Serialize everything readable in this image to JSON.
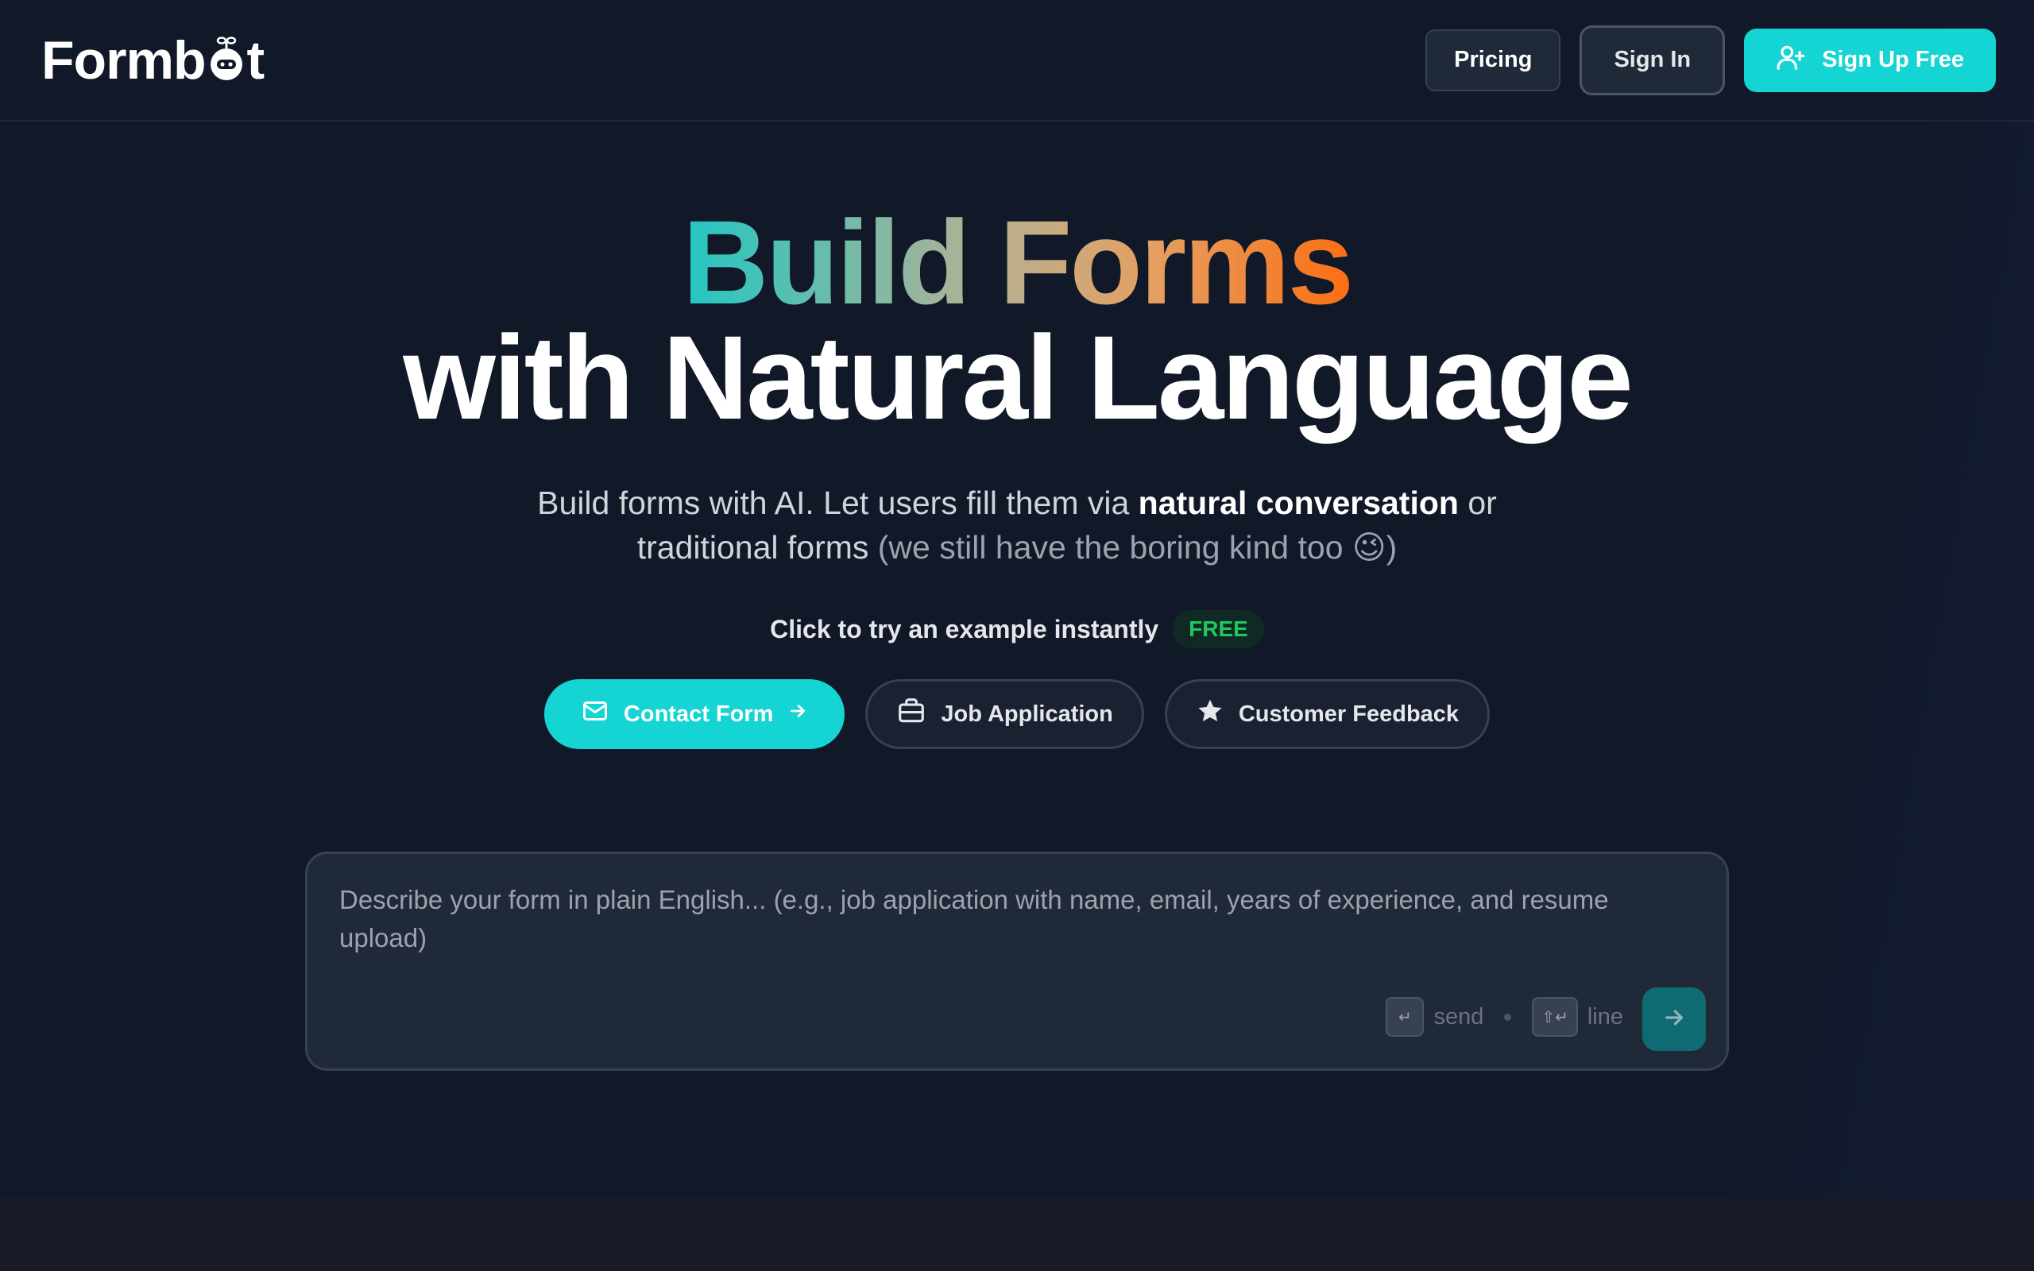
{
  "header": {
    "logo_text_pre": "Formb",
    "logo_text_post": "t",
    "pricing_label": "Pricing",
    "signin_label": "Sign In",
    "signup_label": "Sign Up Free"
  },
  "hero": {
    "line1_a": "Build",
    "line1_b": "Forms",
    "line2": "with Natural Language",
    "subtitle_a": "Build forms with AI. Let users fill them via ",
    "subtitle_bold": "natural conversation",
    "subtitle_b": " or",
    "subtitle_c": "traditional forms ",
    "subtitle_muted": "(we still have the boring kind too 😉)"
  },
  "examples": {
    "prompt": "Click to try an example instantly",
    "badge": "FREE",
    "items": [
      {
        "label": "Contact Form",
        "icon": "mail-icon"
      },
      {
        "label": "Job Application",
        "icon": "briefcase-icon"
      },
      {
        "label": "Customer Feedback",
        "icon": "star-icon"
      }
    ]
  },
  "composer": {
    "placeholder": "Describe your form in plain English... (e.g., job application with name, email, years of experience, and resume upload)",
    "send_key": "↵",
    "send_hint": "send",
    "line_key": "⇧↵",
    "line_hint": "line"
  },
  "colors": {
    "background": "#111827",
    "accent": "#14d4d4",
    "gradient_start": "#22c7c2",
    "gradient_end": "#fb6e15",
    "free_badge": "#22c55e"
  }
}
